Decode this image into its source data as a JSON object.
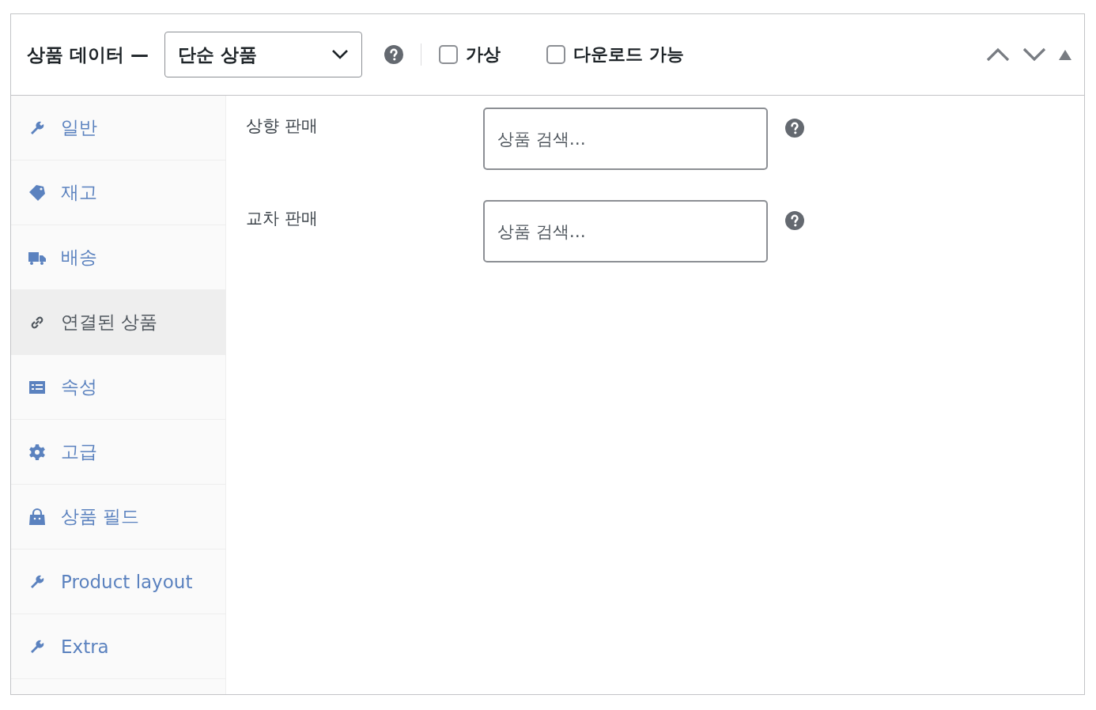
{
  "header": {
    "title": "상품 데이터 —",
    "product_type": {
      "value": "단순 상품"
    },
    "checkboxes": [
      {
        "label": "가상",
        "checked": false
      },
      {
        "label": "다운로드 가능",
        "checked": false
      }
    ]
  },
  "tabs": [
    {
      "label": "일반",
      "selected": false
    },
    {
      "label": "재고",
      "selected": false
    },
    {
      "label": "배송",
      "selected": false
    },
    {
      "label": "연결된 상품",
      "selected": true
    },
    {
      "label": "속성",
      "selected": false
    },
    {
      "label": "고급",
      "selected": false
    },
    {
      "label": "상품 필드",
      "selected": false
    },
    {
      "label": "Product layout",
      "selected": false
    },
    {
      "label": "Extra",
      "selected": false
    }
  ],
  "fields": [
    {
      "label": "상향 판매",
      "placeholder": "상품 검색…"
    },
    {
      "label": "교차 판매",
      "placeholder": "상품 검색…"
    }
  ]
}
